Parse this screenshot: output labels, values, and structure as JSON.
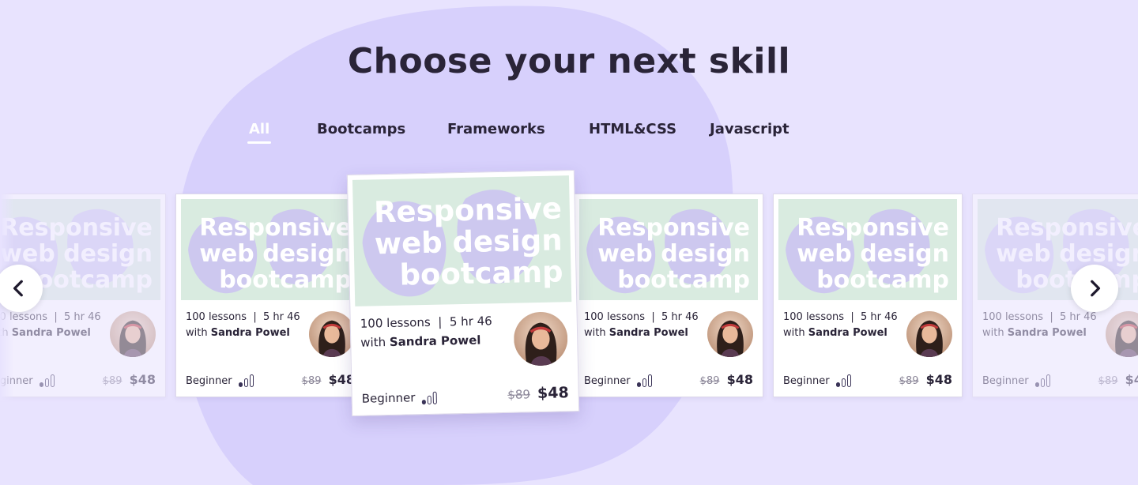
{
  "heading": "Choose your next skill",
  "tabs": [
    {
      "label": "All",
      "active": true
    },
    {
      "label": "Bootcamps"
    },
    {
      "label": "Frameworks"
    },
    {
      "label": "HTML&CSS"
    },
    {
      "label": "Javascript"
    }
  ],
  "course": {
    "title_line1": "Responsive",
    "title_line2": "web design",
    "title_line3": "bootcamp",
    "lessons": "100 lessons",
    "separator": "|",
    "duration": "5 hr 46",
    "with_label": "with",
    "instructor": "Sandra Powel",
    "level": "Beginner",
    "old_price": "$89",
    "price": "$48"
  },
  "colors": {
    "background": "#e8e3fe",
    "blob": "#d7d0fc",
    "thumb_bg": "#d9ebe0",
    "thumb_blob": "#cdc8ef",
    "heading": "#2a2438"
  },
  "icons": {
    "prev": "chevron-left-icon",
    "next": "chevron-right-icon",
    "level": "signal-bars-icon"
  }
}
